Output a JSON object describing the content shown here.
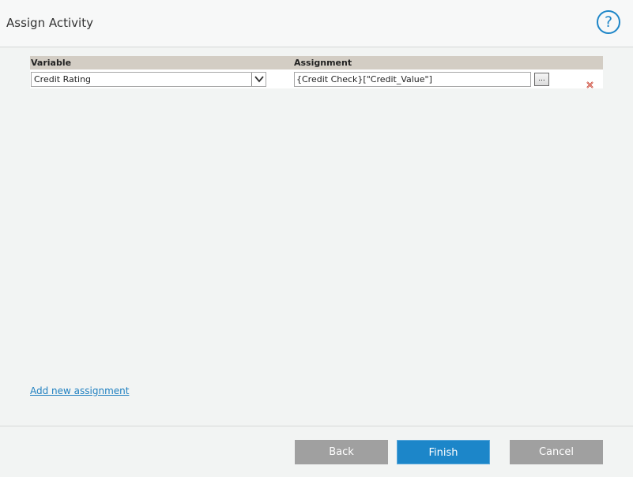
{
  "window": {
    "title": "Assign Activity",
    "help_label": "?"
  },
  "table": {
    "headers": {
      "variable": "Variable",
      "assignment": "Assignment"
    },
    "rows": [
      {
        "variable": "Credit Rating",
        "assignment": "{Credit Check}[\"Credit_Value\"]",
        "browse_label": "..."
      }
    ]
  },
  "add_link": "Add new assignment",
  "footer": {
    "back": "Back",
    "finish": "Finish",
    "cancel": "Cancel"
  },
  "colors": {
    "accent": "#1c86c9",
    "header_band": "#d3cdc4",
    "disabled_button": "#a0a0a0"
  },
  "icons": [
    "help-icon",
    "dropdown-arrow-icon",
    "delete-icon"
  ]
}
